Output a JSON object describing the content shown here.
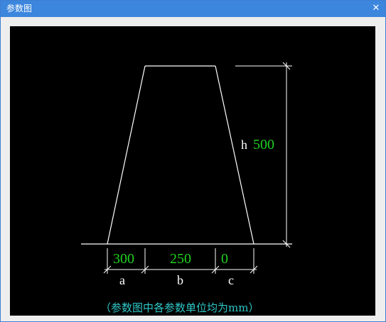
{
  "window": {
    "title": "参数图",
    "close_glyph": "✕"
  },
  "diagram": {
    "values": {
      "a": "300",
      "b": "250",
      "c": "0",
      "h": "500"
    },
    "labels": {
      "a": "a",
      "b": "b",
      "c": "c",
      "h": "h"
    },
    "note": "（参数图中各参数单位均为mm）",
    "colors": {
      "background": "#000000",
      "line": "#ffffff",
      "value": "#1ed21e",
      "note": "#2fc7c7"
    }
  }
}
